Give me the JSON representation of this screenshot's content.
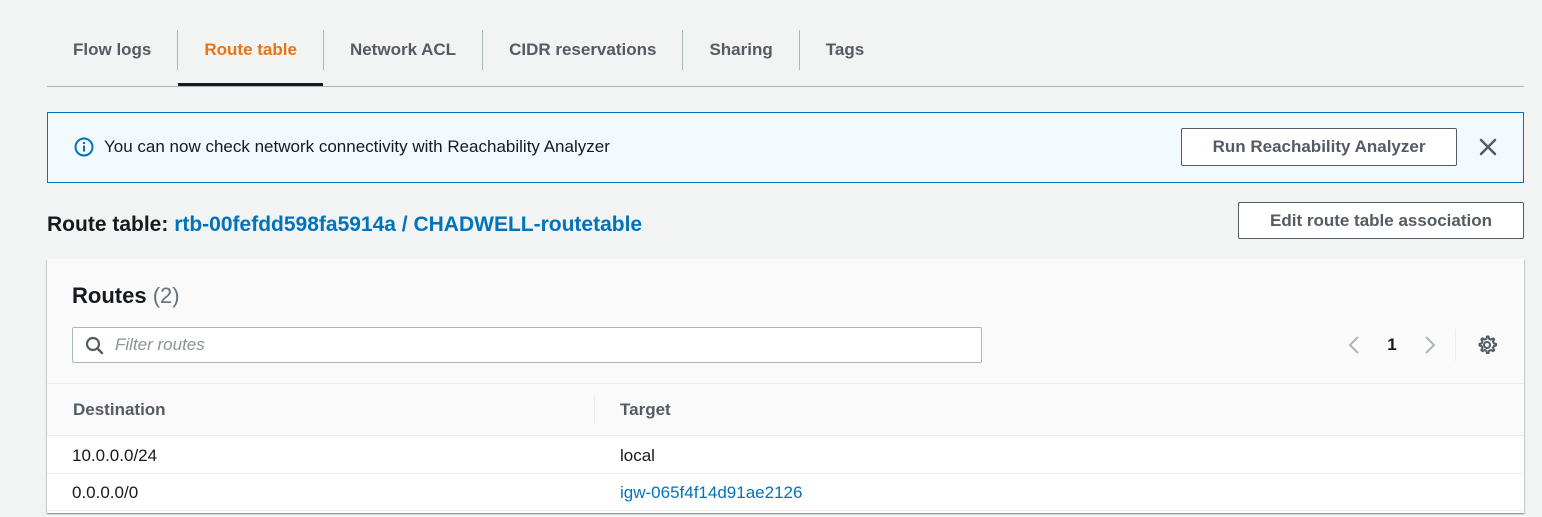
{
  "tabs": [
    {
      "label": "Flow logs",
      "active": false
    },
    {
      "label": "Route table",
      "active": true
    },
    {
      "label": "Network ACL",
      "active": false
    },
    {
      "label": "CIDR reservations",
      "active": false
    },
    {
      "label": "Sharing",
      "active": false
    },
    {
      "label": "Tags",
      "active": false
    }
  ],
  "banner": {
    "message": "You can now check network connectivity with Reachability Analyzer",
    "button_label": "Run Reachability Analyzer",
    "icon": "info-icon"
  },
  "route_table": {
    "heading_label": "Route table:",
    "link_text": "rtb-00fefdd598fa5914a / CHADWELL-routetable",
    "edit_button_label": "Edit route table association"
  },
  "routes": {
    "title": "Routes",
    "count": "(2)",
    "filter_placeholder": "Filter routes",
    "page": "1",
    "columns": [
      "Destination",
      "Target"
    ],
    "rows": [
      {
        "destination": "10.0.0.0/24",
        "target": "local",
        "target_is_link": false
      },
      {
        "destination": "0.0.0.0/0",
        "target": "igw-065f4f14d91ae2126",
        "target_is_link": true
      }
    ]
  },
  "colors": {
    "accent_orange": "#ec7211",
    "link_blue": "#0073bb",
    "banner_bg": "#f1faff"
  }
}
